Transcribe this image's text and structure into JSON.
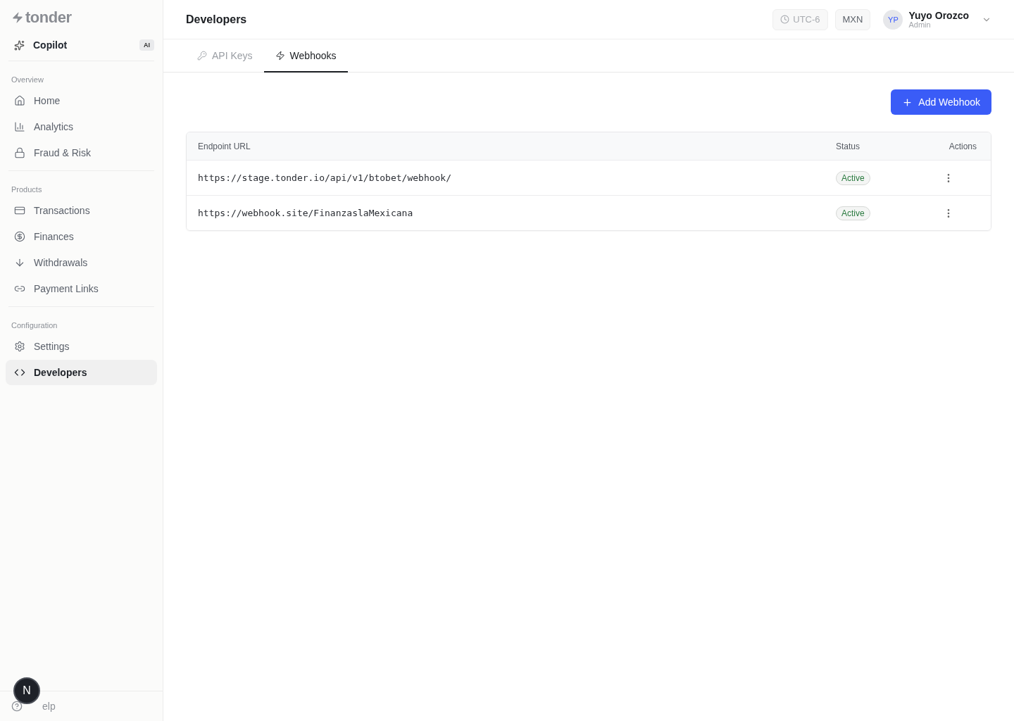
{
  "sidebar": {
    "logo": "tonder",
    "copilot": {
      "label": "Copilot",
      "badge": "AI"
    },
    "sections": [
      {
        "title": "Overview",
        "items": [
          {
            "label": "Home",
            "selected": false
          },
          {
            "label": "Analytics",
            "selected": false
          },
          {
            "label": "Fraud & Risk",
            "selected": false
          }
        ]
      },
      {
        "title": "Products",
        "items": [
          {
            "label": "Transactions",
            "selected": false
          },
          {
            "label": "Finances",
            "selected": false
          },
          {
            "label": "Withdrawals",
            "selected": false
          },
          {
            "label": "Payment Links",
            "selected": false
          }
        ]
      },
      {
        "title": "Configuration",
        "items": [
          {
            "label": "Settings",
            "selected": false
          },
          {
            "label": "Developers",
            "selected": true
          }
        ]
      }
    ],
    "help": "elp",
    "floating_button": "N"
  },
  "header": {
    "title": "Developers",
    "timezone": "UTC-6",
    "currency": "MXN",
    "user": {
      "initials": "YP",
      "name": "Yuyo Orozco",
      "role": "Admin"
    }
  },
  "tabs": [
    {
      "label": "API Keys",
      "selected": false
    },
    {
      "label": "Webhooks",
      "selected": true
    }
  ],
  "add_button": "Add Webhook",
  "table": {
    "columns": [
      "Endpoint URL",
      "Status",
      "Actions"
    ],
    "rows": [
      {
        "url": "https://stage.tonder.io/api/v1/btobet/webhook/",
        "status": "Active"
      },
      {
        "url": "https://webhook.site/FinanzaslaMexicana",
        "status": "Active"
      }
    ]
  }
}
